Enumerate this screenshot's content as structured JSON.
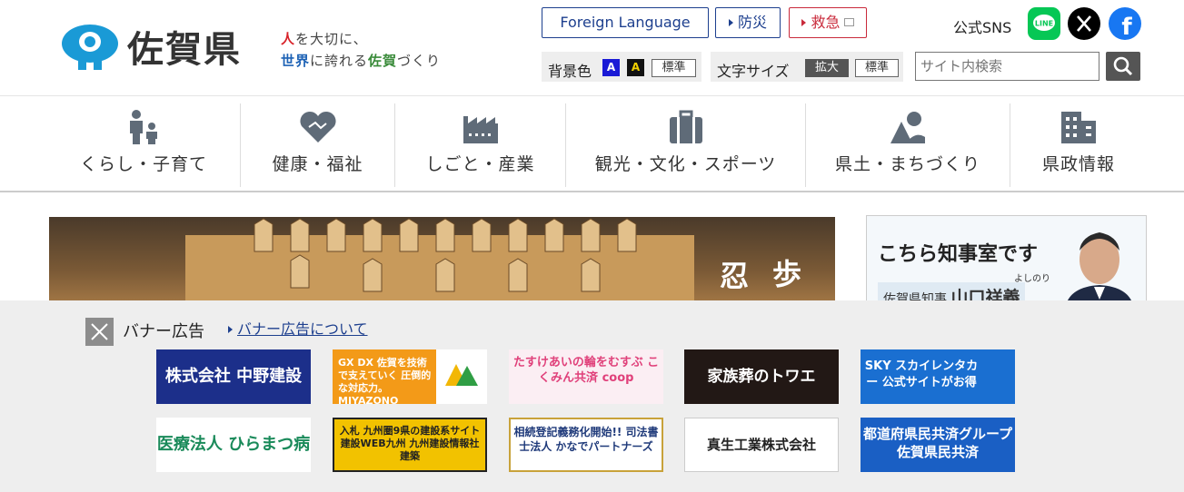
{
  "header": {
    "site_title": "佐賀県",
    "tagline_line1_red": "人",
    "tagline_line1_rest": "を大切に、",
    "tagline_line2_blue": "世界",
    "tagline_line2_mid": "に誇れる",
    "tagline_line2_green": "佐賀",
    "tagline_line2_end": "づくり",
    "foreign_language": "Foreign Language",
    "bousai": "防災",
    "kyukyu": "救急",
    "sns_label": "公式SNS",
    "bg_color_label": "背景色",
    "bg_a1": "A",
    "bg_a2": "A",
    "bg_standard": "標準",
    "font_size_label": "文字サイズ",
    "font_enlarge": "拡大",
    "font_standard": "標準",
    "search_placeholder": "サイト内検索"
  },
  "nav": [
    {
      "label": "くらし・子育て",
      "icon": "family-icon"
    },
    {
      "label": "健康・福祉",
      "icon": "heart-handshake-icon"
    },
    {
      "label": "しごと・産業",
      "icon": "factory-icon"
    },
    {
      "label": "観光・文化・スポーツ",
      "icon": "suitcase-icon"
    },
    {
      "label": "県土・まちづくり",
      "icon": "landscape-icon"
    },
    {
      "label": "県政情報",
      "icon": "building-icon"
    }
  ],
  "banner_main": {
    "text1": "歩",
    "text2": "忍"
  },
  "side_banner": {
    "title": "こちら知事室です",
    "role": "佐賀県知事",
    "name": "山口祥義",
    "ruby": "よしのり"
  },
  "ads": {
    "title": "バナー広告",
    "about_link": "バナー広告について",
    "items": [
      {
        "label": "株式会社 中野建設"
      },
      {
        "label": "GX DX 佐賀を技術で支えていく 圧倒的な対応力。 MIYAZONO"
      },
      {
        "label": "たすけあいの輪をむすぶ こくみん共済 coop"
      },
      {
        "label": "家族葬のトワエ"
      },
      {
        "label": "SKY スカイレンタカー 公式サイトがお得"
      },
      {
        "label": "医療法人 ひらまつ病院"
      },
      {
        "label": "入札 九州圏9県の建設系サイト 建設WEB九州 九州建設情報社 建築"
      },
      {
        "label": "相続登記義務化開始!! 司法書士法人 かなでパートナーズ"
      },
      {
        "label": "真生工業株式会社"
      },
      {
        "label": "都道府県民共済グループ 佐賀県民共済"
      }
    ]
  },
  "colors": {
    "brand_blue": "#1d3f8e",
    "emergency_red": "#c92a3b",
    "logo_blue": "#1a9ad6"
  }
}
